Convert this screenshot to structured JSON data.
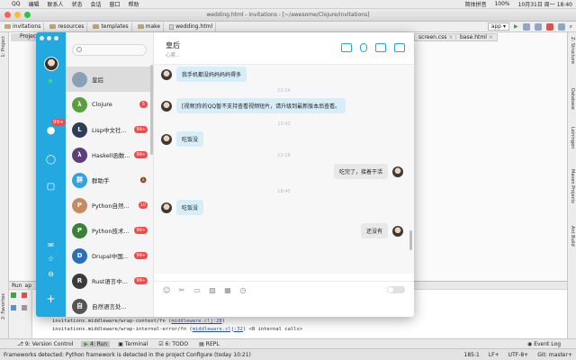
{
  "menubar": {
    "items": [
      "QQ",
      "编辑",
      "联系人",
      "状态",
      "会话",
      "窗口",
      "帮助"
    ],
    "right": [
      "简体拼音",
      "100%",
      "10月31日 周一 18:40"
    ]
  },
  "ide": {
    "title": "wedding.html - invitations - [~/awesome/Clojure/invitations]",
    "crumbs": [
      "invitations",
      "resources",
      "templates",
      "make",
      "wedding.html"
    ],
    "run_label": "app",
    "project_tab": "Project",
    "editor_tabs": [
      "screen.css",
      "base.html"
    ],
    "left_strip": [
      "1: Project",
      "2: Favorites"
    ],
    "right_strip": [
      "Z: Structure",
      "Database",
      "Leiningen",
      "Maven Projects",
      "Ant Build"
    ],
    "run_tab": "Run",
    "run_tab_name": "ap",
    "log_lines": [
      {
        "prefix": "invitations.middleware/wrap-context/fn (",
        "link": "middleware.clj:28",
        "suffix": ")"
      },
      {
        "prefix": "invitations.middleware/wrap-internal-error/fn (",
        "link": "middleware.clj:32",
        "suffix": ") <8 internal calls>"
      }
    ],
    "bottom_tools": [
      "9: Version Control",
      "4: Run",
      "Terminal",
      "6: TODO",
      "REPL"
    ],
    "event_log": "Event Log",
    "status_text": "Frameworks detected: Python framework is detected in the project Configure (today 10:21)",
    "status_right": [
      "185:1",
      "LF+",
      "UTF-8+",
      "Git: master+"
    ]
  },
  "qq": {
    "search": {
      "placeholder": "",
      "value": ""
    },
    "badge_main": "99+",
    "chats": [
      {
        "name": "皇后",
        "badge": "",
        "muted": false,
        "color": "#8aa0b8",
        "initial": ""
      },
      {
        "name": "Clojure",
        "badge": "5",
        "muted": false,
        "color": "#5b9e3f",
        "initial": "λ"
      },
      {
        "name": "Lisp中文社...",
        "badge": "99+",
        "muted": false,
        "color": "#2d3e55",
        "initial": "L"
      },
      {
        "name": "Haskell函数...",
        "badge": "99+",
        "muted": false,
        "color": "#5a3f7a",
        "initial": "λ"
      },
      {
        "name": "群助手",
        "badge": "",
        "muted": true,
        "color": "#34a2e0",
        "initial": "群"
      },
      {
        "name": "Python自然...",
        "badge": "10",
        "muted": false,
        "color": "#c58b63",
        "initial": "P"
      },
      {
        "name": "Python技术...",
        "badge": "99+",
        "muted": false,
        "color": "#3a7f3a",
        "initial": "P"
      },
      {
        "name": "Drupal中国...",
        "badge": "99+",
        "muted": false,
        "color": "#2a6fb8",
        "initial": "D"
      },
      {
        "name": "Rust语言中...",
        "badge": "99+",
        "muted": false,
        "color": "#3b3b3b",
        "initial": "R"
      },
      {
        "name": "自然语言处...",
        "badge": "",
        "muted": false,
        "color": "#555555",
        "initial": "自"
      }
    ],
    "chat": {
      "title": "皇后",
      "subtitle": "心寒...",
      "messages": [
        {
          "dir": "in",
          "text": "我手机都没妈妈妈妈得多"
        },
        {
          "dir": "ts",
          "text": "12:24"
        },
        {
          "dir": "in",
          "text": "[视频]你的QQ暂不支持查看视频短片，请升级到最新版本后查看。"
        },
        {
          "dir": "ts",
          "text": "13:43"
        },
        {
          "dir": "in",
          "text": "吃饭没"
        },
        {
          "dir": "ts",
          "text": "13:18"
        },
        {
          "dir": "out",
          "text": "吃完了，接着干活"
        },
        {
          "dir": "ts",
          "text": "18:40"
        },
        {
          "dir": "in",
          "text": "吃饭没"
        },
        {
          "dir": "out",
          "text": "还没有"
        }
      ]
    }
  },
  "colors": {
    "qq_blue": "#23a8e0",
    "badge_red": "#f24a4a",
    "bubble_in": "#d7edf7",
    "bubble_out": "#e8e8e8"
  }
}
